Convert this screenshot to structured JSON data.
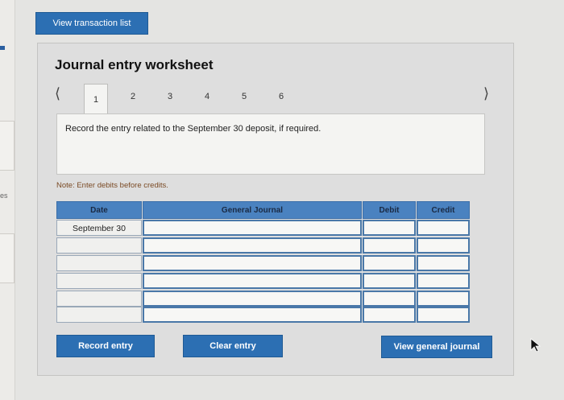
{
  "header": {
    "view_transaction_list": "View transaction list"
  },
  "left_panel": {
    "fragment_text": "es"
  },
  "worksheet": {
    "title": "Journal entry worksheet",
    "tabs": [
      "1",
      "2",
      "3",
      "4",
      "5",
      "6"
    ],
    "active_tab": "1",
    "prompt": "Record the entry related to the September 30 deposit, if required.",
    "note": "Note: Enter debits before credits."
  },
  "table": {
    "columns": {
      "date": "Date",
      "general_journal": "General Journal",
      "debit": "Debit",
      "credit": "Credit"
    },
    "rows": [
      {
        "date": "September 30",
        "account": "",
        "debit": "",
        "credit": ""
      },
      {
        "date": "",
        "account": "",
        "debit": "",
        "credit": ""
      },
      {
        "date": "",
        "account": "",
        "debit": "",
        "credit": ""
      },
      {
        "date": "",
        "account": "",
        "debit": "",
        "credit": ""
      },
      {
        "date": "",
        "account": "",
        "debit": "",
        "credit": ""
      },
      {
        "date": "",
        "account": "",
        "debit": "",
        "credit": ""
      }
    ]
  },
  "buttons": {
    "record_entry": "Record entry",
    "clear_entry": "Clear entry",
    "view_general_journal": "View general journal"
  },
  "colors": {
    "button_blue": "#2c6fb3",
    "table_header_blue": "#4a82c0",
    "background": "#e4e4e2"
  }
}
